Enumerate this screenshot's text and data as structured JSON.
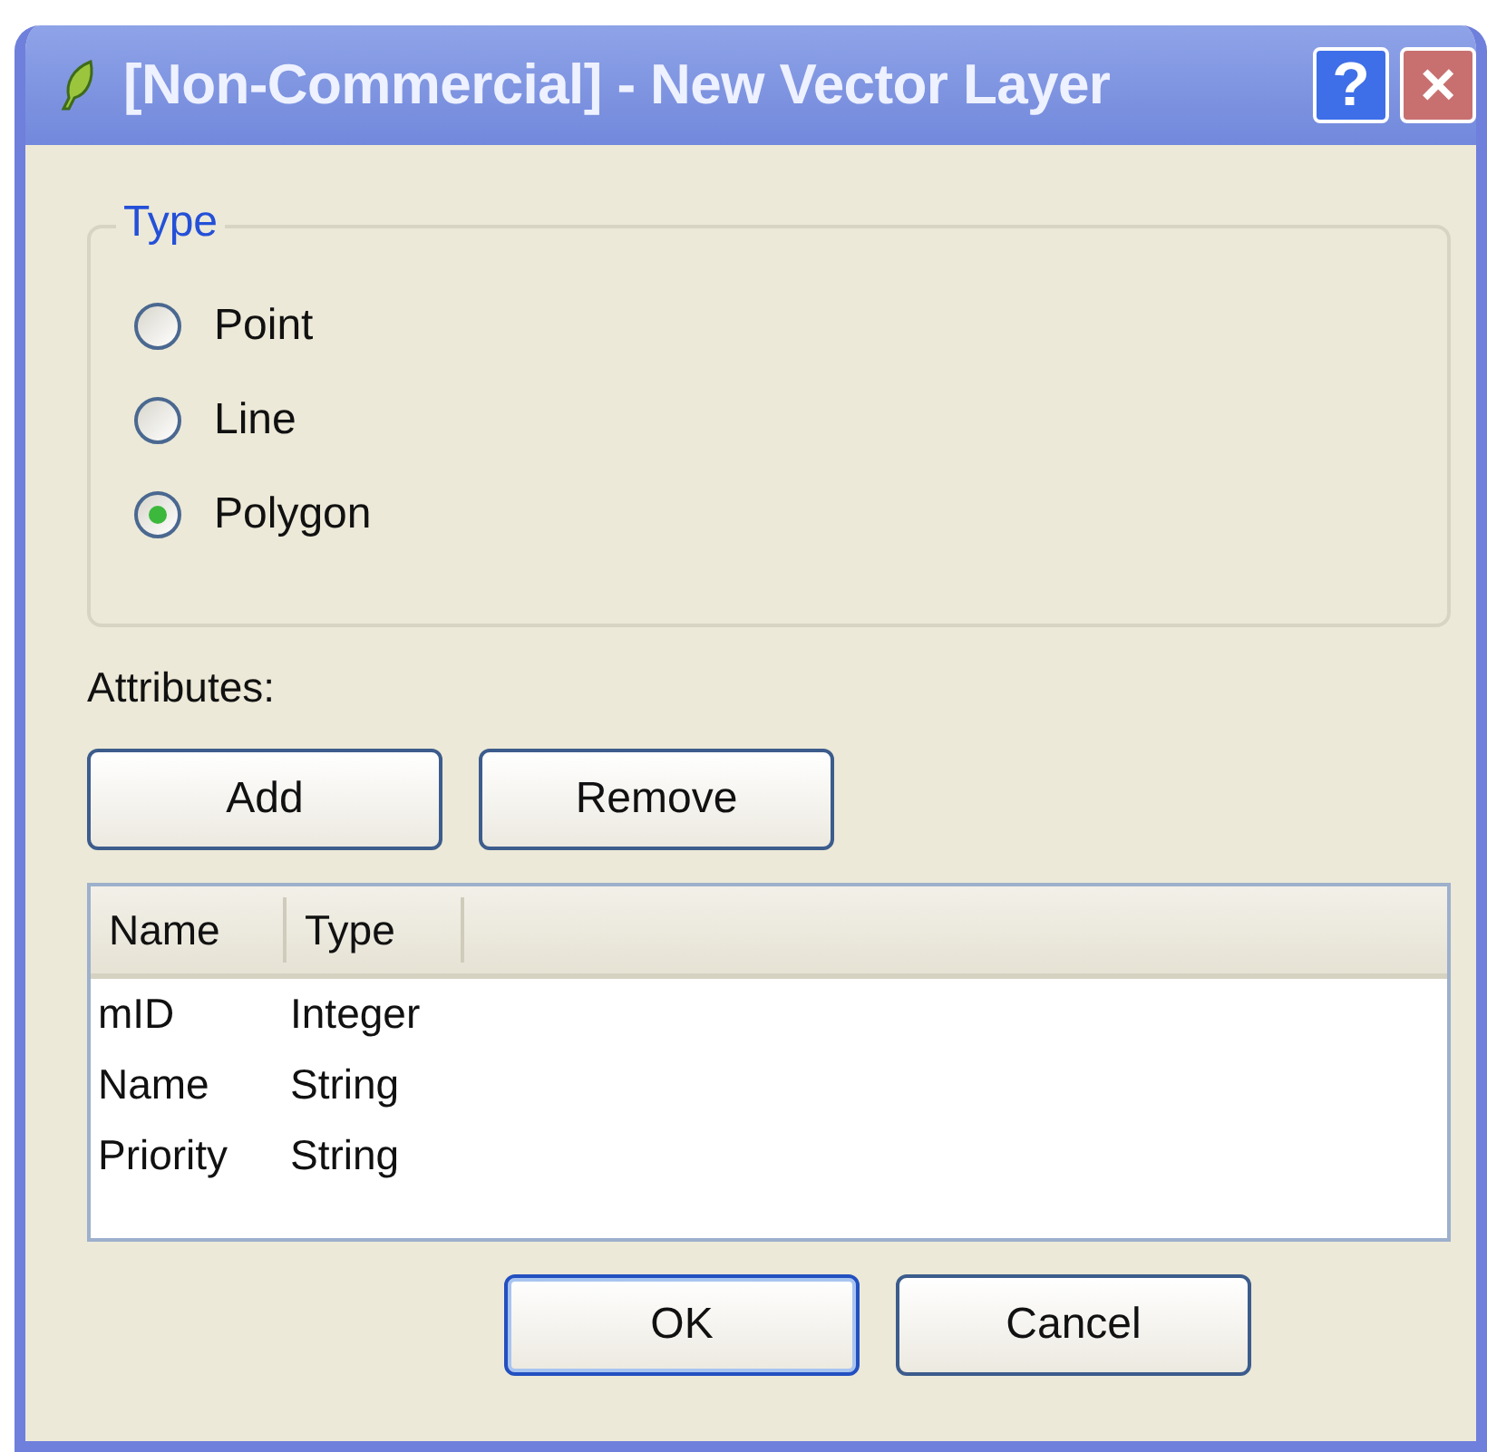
{
  "window": {
    "title": "[Non-Commercial] - New Vector Layer",
    "help": "?",
    "close": "×"
  },
  "type_group": {
    "title": "Type",
    "options": [
      {
        "label": "Point",
        "selected": false
      },
      {
        "label": "Line",
        "selected": false
      },
      {
        "label": "Polygon",
        "selected": true
      }
    ]
  },
  "attributes_label": "Attributes:",
  "attribute_buttons": [
    "Add",
    "Remove"
  ],
  "table": {
    "columns": [
      "Name",
      "Type"
    ],
    "rows": [
      [
        "mID",
        "Integer"
      ],
      [
        "Name",
        "String"
      ],
      [
        "Priority",
        "String"
      ]
    ]
  },
  "buttons": [
    {
      "label": "OK",
      "default": true
    },
    {
      "label": "Cancel",
      "default": false
    }
  ]
}
